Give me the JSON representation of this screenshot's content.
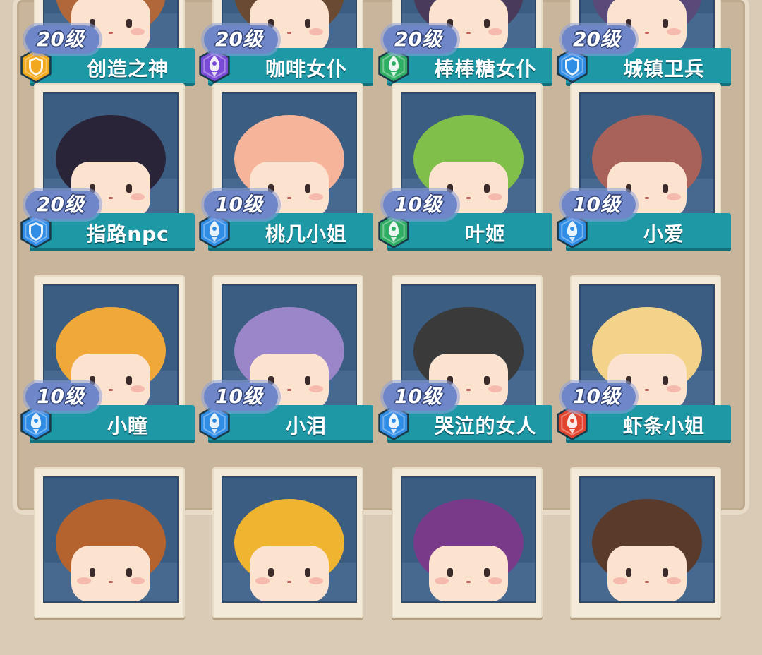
{
  "rows": [
    [
      {
        "name": "创造之神",
        "level": "20级",
        "rank": "gold",
        "rank_color": "#f2a81d",
        "rank_icon": "shield-icon",
        "hair": "#b0673a"
      },
      {
        "name": "咖啡女仆",
        "level": "20级",
        "rank": "purple",
        "rank_color": "#7a4bd6",
        "rank_icon": "rocket-icon",
        "hair": "#6a4a32"
      },
      {
        "name": "棒棒糖女仆",
        "level": "20级",
        "rank": "green",
        "rank_color": "#2fae63",
        "rank_icon": "rocket-icon",
        "hair": "#4a3a5a"
      },
      {
        "name": "城镇卫兵",
        "level": "20级",
        "rank": "blue",
        "rank_color": "#2f8de6",
        "rank_icon": "shield-icon",
        "hair": "#5a4a7a"
      }
    ],
    [
      {
        "name": "指路npc",
        "level": "20级",
        "rank": "blue",
        "rank_color": "#2f8de6",
        "rank_icon": "shield-icon",
        "hair": "#2a2438"
      },
      {
        "name": "桃几小姐",
        "level": "10级",
        "rank": "blue",
        "rank_color": "#2f8de6",
        "rank_icon": "rocket-icon",
        "hair": "#f6b49a"
      },
      {
        "name": "叶姬",
        "level": "10级",
        "rank": "green",
        "rank_color": "#2fae63",
        "rank_icon": "rocket-icon",
        "hair": "#7fbf4a"
      },
      {
        "name": "小爱",
        "level": "10级",
        "rank": "blue",
        "rank_color": "#2f8de6",
        "rank_icon": "rocket-icon",
        "hair": "#a8625a"
      }
    ],
    [
      {
        "name": "小瞳",
        "level": "10级",
        "rank": "blue",
        "rank_color": "#2f8de6",
        "rank_icon": "rocket-icon",
        "hair": "#f0a838"
      },
      {
        "name": "小泪",
        "level": "10级",
        "rank": "blue",
        "rank_color": "#2f8de6",
        "rank_icon": "rocket-icon",
        "hair": "#9a86c8"
      },
      {
        "name": "哭泣的女人",
        "level": "10级",
        "rank": "blue",
        "rank_color": "#2f8de6",
        "rank_icon": "rocket-icon",
        "hair": "#3a3a3a"
      },
      {
        "name": "虾条小姐",
        "level": "10级",
        "rank": "red",
        "rank_color": "#e2452e",
        "rank_icon": "rocket-icon",
        "hair": "#f3d28a"
      }
    ],
    [
      {
        "name": "",
        "level": "",
        "rank": "",
        "rank_color": "#2f8de6",
        "rank_icon": "",
        "hair": "#b5632e"
      },
      {
        "name": "",
        "level": "",
        "rank": "",
        "rank_color": "#2f8de6",
        "rank_icon": "",
        "hair": "#f0b530"
      },
      {
        "name": "",
        "level": "",
        "rank": "",
        "rank_color": "#2f8de6",
        "rank_icon": "",
        "hair": "#7a3a8a"
      },
      {
        "name": "",
        "level": "",
        "rank": "",
        "rank_color": "#2f8de6",
        "rank_icon": "",
        "hair": "#5a3a2a"
      }
    ]
  ]
}
